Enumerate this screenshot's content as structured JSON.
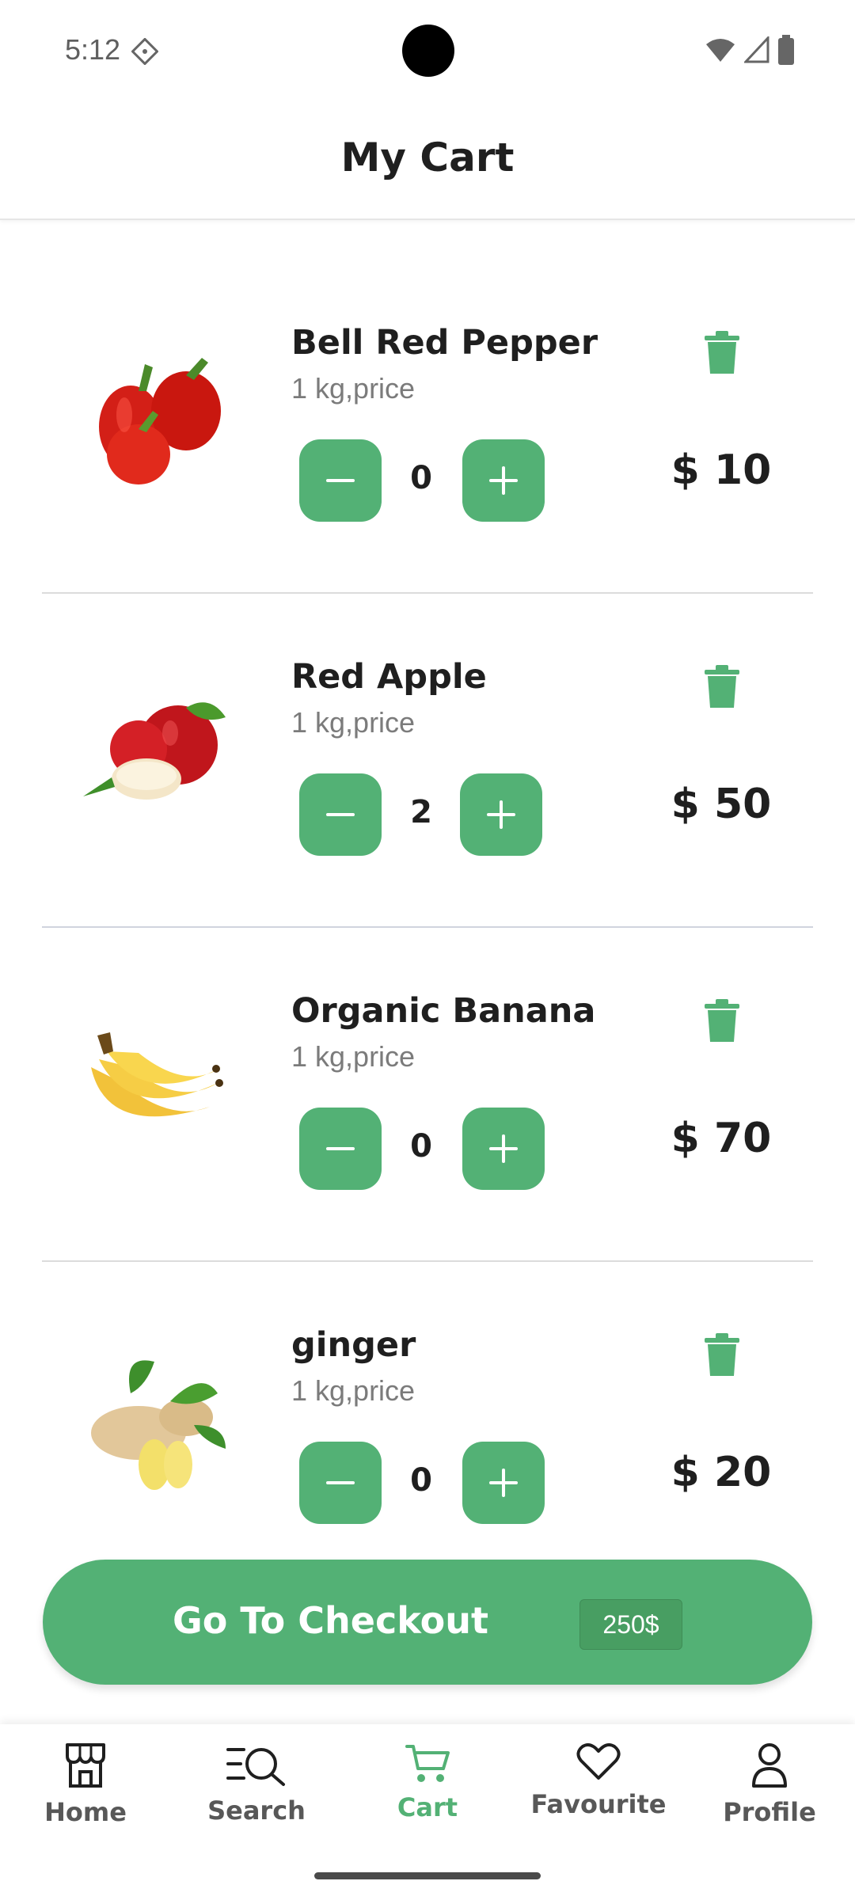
{
  "status_bar": {
    "time": "5:12"
  },
  "header": {
    "title": "My Cart"
  },
  "cart": {
    "items": [
      {
        "name": "Bell Red Pepper",
        "unit": "1 kg,price",
        "quantity": "0",
        "price": "$ 10",
        "image": "red-bell-pepper"
      },
      {
        "name": "Red Apple",
        "unit": "1 kg,price",
        "quantity": "2",
        "price": "$ 50",
        "image": "red-apple"
      },
      {
        "name": "Organic Banana",
        "unit": "1 kg,price",
        "quantity": "0",
        "price": "$ 70",
        "image": "banana-bunch"
      },
      {
        "name": "ginger",
        "unit": "1 kg,price",
        "quantity": "0",
        "price": "$ 20",
        "image": "ginger-root"
      }
    ]
  },
  "checkout": {
    "label": "Go To Checkout",
    "total": "250$"
  },
  "nav": {
    "items": [
      {
        "label": "Home",
        "icon": "store-icon"
      },
      {
        "label": "Search",
        "icon": "search-icon"
      },
      {
        "label": "Cart",
        "icon": "cart-icon",
        "active": true
      },
      {
        "label": "Favourite",
        "icon": "heart-icon"
      },
      {
        "label": "Profile",
        "icon": "user-icon"
      }
    ]
  },
  "colors": {
    "accent": "#53B175",
    "text": "#1F1F1F",
    "muted": "#7B7B7B"
  }
}
